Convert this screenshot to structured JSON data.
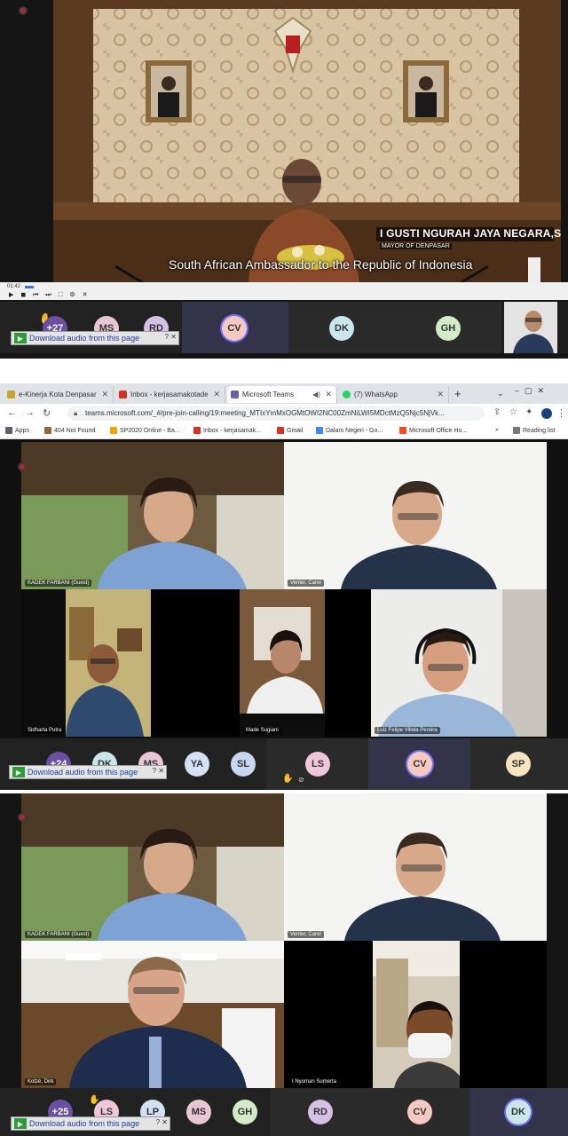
{
  "colors": {
    "accent": "#6264a7",
    "rec": "#b3262b",
    "download": "#1c3ea0"
  },
  "panel1": {
    "lower_third_name": "I GUSTI NGURAH JAYA NEGARA,SE.",
    "lower_third_title": "MAYOR OF DENPASAR",
    "subtitle": "South African Ambassador to the Republic of Indonesia",
    "player_time": "01:42",
    "participants": [
      {
        "initials": "+27",
        "color": "#6b4fa0"
      },
      {
        "initials": "MS",
        "color": "#e9c6d6"
      },
      {
        "initials": "RD",
        "color": "#d6c1e6"
      },
      {
        "initials": "CV",
        "color": "#f5c9c2"
      },
      {
        "initials": "DK",
        "color": "#c8e6ec"
      },
      {
        "initials": "GH",
        "color": "#d1ecc6"
      }
    ]
  },
  "download_label": "Download audio from this page",
  "browser": {
    "tabs": [
      {
        "label": "e-Kinerja Kota Denpasar",
        "icon": "ekinerja-icon",
        "color": "#c9a227"
      },
      {
        "label": "Inbox - kerjasamakotade",
        "icon": "gmail-icon",
        "color": "#d93025"
      },
      {
        "label": "Microsoft Teams",
        "icon": "teams-icon",
        "color": "#6264a7"
      },
      {
        "label": "(7) WhatsApp",
        "icon": "whatsapp-icon",
        "color": "#25d366"
      }
    ],
    "new_tab": "+",
    "url": "teams.microsoft.com/_#/pre-join-calling/19:meeting_MTIxYmMxOGMtOWI2NC00ZmNiLWI5MDctMzQ5Njc5NjVk...",
    "bookmarks": [
      {
        "label": "Apps",
        "color": "#5f6368"
      },
      {
        "label": "404 Not Found",
        "color": "#8a6d3b"
      },
      {
        "label": "SP2020 Online - Ba...",
        "color": "#f0a500"
      },
      {
        "label": "Inbox - kerjasamak...",
        "color": "#d93025"
      },
      {
        "label": "Gmail",
        "color": "#d93025"
      },
      {
        "label": "Dalam Negeri - Go...",
        "color": "#4285f4"
      },
      {
        "label": "Microsoft Office Ho...",
        "color": "#f25022"
      }
    ],
    "reading_list": "Reading list"
  },
  "panel2": {
    "tiles": [
      "KADEK FARBANI (Guest)",
      "Venter, Carel",
      "Sidharta Putra",
      "Made Sugiani",
      "Luiz Felipe Villela Pereira"
    ],
    "participants": [
      {
        "initials": "+24",
        "color": "#6b4fa0"
      },
      {
        "initials": "DK",
        "color": "#c8e6ec"
      },
      {
        "initials": "MS",
        "color": "#e9c6d6"
      },
      {
        "initials": "YA",
        "color": "#d4e1f5"
      },
      {
        "initials": "SL",
        "color": "#c9d6f0"
      },
      {
        "initials": "LS",
        "color": "#f0c6da"
      },
      {
        "initials": "CV",
        "color": "#f5c9c2"
      },
      {
        "initials": "SP",
        "color": "#f7e3c0"
      }
    ]
  },
  "panel3": {
    "tiles": [
      "KADEK FARBANI (Guest)",
      "Venter, Carel",
      "Kotzé, Dirk",
      "I Nyoman Sumerta"
    ],
    "participants": [
      {
        "initials": "+25",
        "color": "#6b4fa0"
      },
      {
        "initials": "LS",
        "color": "#f0c6da"
      },
      {
        "initials": "LP",
        "color": "#d4e1f5"
      },
      {
        "initials": "MS",
        "color": "#e9c6d6"
      },
      {
        "initials": "GH",
        "color": "#d1ecc6"
      },
      {
        "initials": "RD",
        "color": "#d6c1e6"
      },
      {
        "initials": "CV",
        "color": "#f5c9c2"
      },
      {
        "initials": "DK",
        "color": "#c8e6ec"
      }
    ]
  }
}
